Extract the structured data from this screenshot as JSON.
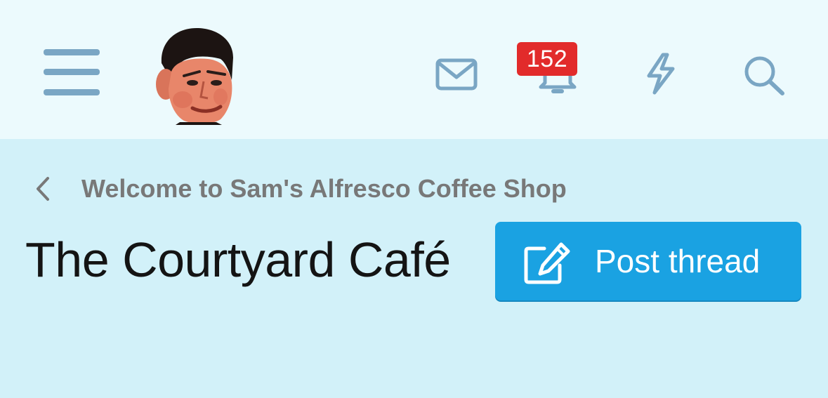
{
  "header": {
    "notification_count": "152",
    "icons": [
      "menu-icon",
      "mail-icon",
      "bell-icon",
      "lightning-icon",
      "search-icon"
    ]
  },
  "breadcrumb": {
    "label": "Welcome to Sam's Alfresco Coffee Shop"
  },
  "page": {
    "title": "The Courtyard Café"
  },
  "actions": {
    "post_thread_label": "Post thread"
  },
  "colors": {
    "header_bg": "#ecfafd",
    "body_bg": "#d2f1f9",
    "icon_color": "#7aa6c4",
    "badge_red": "#e22b2b",
    "button_blue": "#1aa2e2"
  }
}
